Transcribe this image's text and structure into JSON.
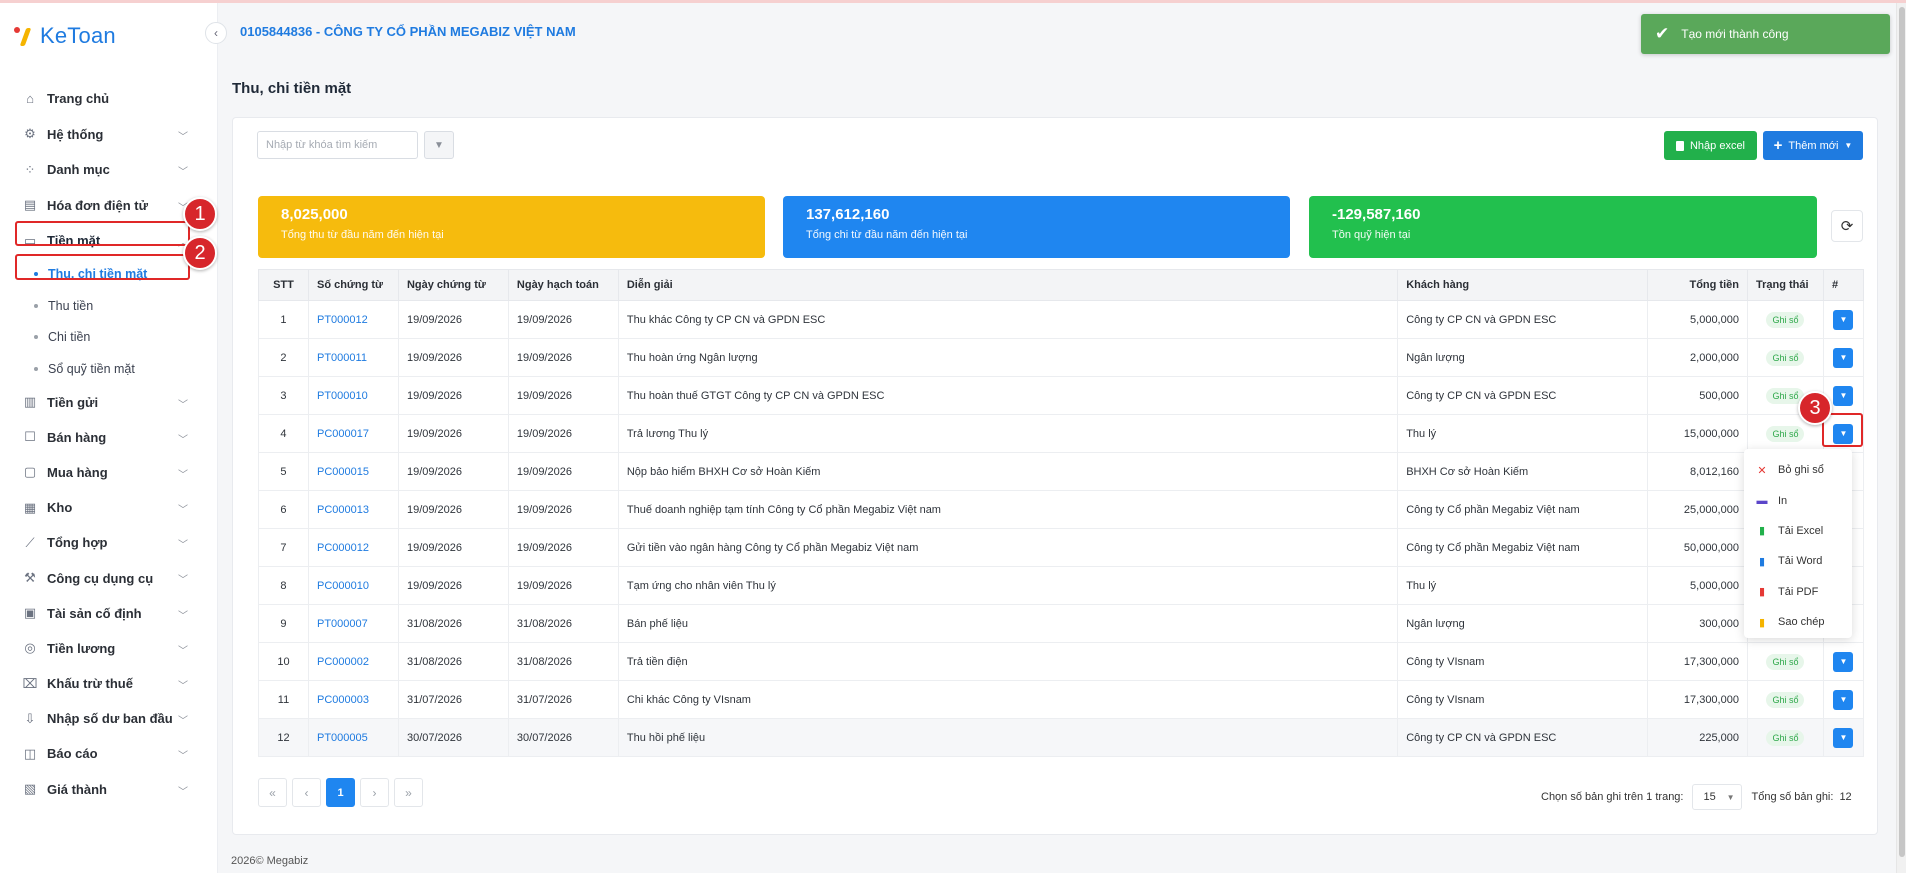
{
  "app": {
    "name": "KeToan"
  },
  "header": {
    "company": "0105844836 - CÔNG TY CỔ PHẦN MEGABIZ VIỆT NAM"
  },
  "toast": {
    "message": "Tạo mới thành công"
  },
  "sidebar": {
    "items": [
      {
        "label": "Trang chủ",
        "icon": "home-icon",
        "chevron": false
      },
      {
        "label": "Hệ thống",
        "icon": "gear-icon",
        "chevron": true
      },
      {
        "label": "Danh mục",
        "icon": "grid-icon",
        "chevron": true
      },
      {
        "label": "Hóa đơn điện tử",
        "icon": "invoice-icon",
        "chevron": true
      },
      {
        "label": "Tiền mặt",
        "icon": "cash-icon",
        "chevron": true,
        "open": true
      }
    ],
    "cash_sub": [
      "Thu, chi tiền mặt",
      "Thu tiền",
      "Chi tiền",
      "Sổ quỹ tiền mặt"
    ],
    "items_after": [
      {
        "label": "Tiền gửi",
        "icon": "bank-icon"
      },
      {
        "label": "Bán hàng",
        "icon": "sales-icon"
      },
      {
        "label": "Mua hàng",
        "icon": "purchase-icon"
      },
      {
        "label": "Kho",
        "icon": "warehouse-icon"
      },
      {
        "label": "Tổng hợp",
        "icon": "chart-icon"
      },
      {
        "label": "Công cụ dụng cụ",
        "icon": "tools-icon"
      },
      {
        "label": "Tài sản cố định",
        "icon": "asset-icon"
      },
      {
        "label": "Tiền lương",
        "icon": "salary-icon"
      },
      {
        "label": "Khấu trừ thuế",
        "icon": "tax-icon"
      },
      {
        "label": "Nhập số dư ban đầu",
        "icon": "import-icon"
      },
      {
        "label": "Báo cáo",
        "icon": "report-icon"
      },
      {
        "label": "Giá thành",
        "icon": "cost-icon"
      }
    ]
  },
  "page": {
    "title": "Thu, chi tiền mặt"
  },
  "toolbar": {
    "search_placeholder": "Nhập từ khóa tìm kiếm",
    "excel_label": "Nhập excel",
    "add_label": "Thêm mới"
  },
  "stats": {
    "income": {
      "value": "8,025,000",
      "label": "Tổng thu từ đầu năm đến hiện tại"
    },
    "expense": {
      "value": "137,612,160",
      "label": "Tổng chi từ đầu năm đến hiện tại"
    },
    "balance": {
      "value": "-129,587,160",
      "label": "Tồn quỹ hiện tại"
    }
  },
  "table": {
    "headers": [
      "STT",
      "Số chứng từ",
      "Ngày chứng từ",
      "Ngày hạch toán",
      "Diễn giải",
      "Khách hàng",
      "Tổng tiền",
      "Trạng thái",
      "#"
    ],
    "rows": [
      [
        "1",
        "PT000012",
        "19/09/2026",
        "19/09/2026",
        "Thu khác Công ty CP CN và GPDN ESC",
        "Công ty CP CN và GPDN ESC",
        "5,000,000",
        "Ghi sổ"
      ],
      [
        "2",
        "PT000011",
        "19/09/2026",
        "19/09/2026",
        "Thu hoàn ứng Ngân lượng",
        "Ngân lượng",
        "2,000,000",
        "Ghi sổ"
      ],
      [
        "3",
        "PT000010",
        "19/09/2026",
        "19/09/2026",
        "Thu hoàn thuế GTGT Công ty CP CN và GPDN ESC",
        "Công ty CP CN và GPDN ESC",
        "500,000",
        "Ghi sổ"
      ],
      [
        "4",
        "PC000017",
        "19/09/2026",
        "19/09/2026",
        "Trả lương Thu lý",
        "Thu lý",
        "15,000,000",
        "Ghi sổ"
      ],
      [
        "5",
        "PC000015",
        "19/09/2026",
        "19/09/2026",
        "Nộp bảo hiểm BHXH Cơ sở Hoàn Kiếm",
        "BHXH Cơ sở Hoàn Kiếm",
        "8,012,160",
        ""
      ],
      [
        "6",
        "PC000013",
        "19/09/2026",
        "19/09/2026",
        "Thuế doanh nghiệp tạm tính Công ty Cổ phần Megabiz Việt nam",
        "Công ty Cổ phần Megabiz Việt nam",
        "25,000,000",
        ""
      ],
      [
        "7",
        "PC000012",
        "19/09/2026",
        "19/09/2026",
        "Gửi tiền vào ngân hàng Công ty Cổ phần Megabiz Việt nam",
        "Công ty Cổ phần Megabiz Việt nam",
        "50,000,000",
        ""
      ],
      [
        "8",
        "PC000010",
        "19/09/2026",
        "19/09/2026",
        "Tạm ứng cho nhân viên Thu lý",
        "Thu lý",
        "5,000,000",
        ""
      ],
      [
        "9",
        "PT000007",
        "31/08/2026",
        "31/08/2026",
        "Bán phế liệu",
        "Ngân lượng",
        "300,000",
        ""
      ],
      [
        "10",
        "PC000002",
        "31/08/2026",
        "31/08/2026",
        "Trả tiền điện",
        "Công ty VIsnam",
        "17,300,000",
        "Ghi sổ"
      ],
      [
        "11",
        "PC000003",
        "31/07/2026",
        "31/07/2026",
        "Chi khác Công ty VIsnam",
        "Công ty VIsnam",
        "17,300,000",
        "Ghi sổ"
      ],
      [
        "12",
        "PT000005",
        "30/07/2026",
        "30/07/2026",
        "Thu hồi phế liệu",
        "Công ty CP CN và GPDN ESC",
        "225,000",
        "Ghi sổ"
      ]
    ]
  },
  "dropdown": {
    "items": [
      {
        "label": "Bỏ ghi sổ",
        "icon": "x-icon",
        "color": "#e53935"
      },
      {
        "label": "In",
        "icon": "printer-icon",
        "color": "#5b45c9"
      },
      {
        "label": "Tải Excel",
        "icon": "excel-icon",
        "color": "#22b04b"
      },
      {
        "label": "Tải Word",
        "icon": "word-icon",
        "color": "#1f7be0"
      },
      {
        "label": "Tải PDF",
        "icon": "pdf-icon",
        "color": "#e53935"
      },
      {
        "label": "Sao chép",
        "icon": "copy-icon",
        "color": "#f5b400"
      }
    ]
  },
  "pagination": {
    "current": "1",
    "per_page_label": "Chọn số bản ghi trên 1 trang:",
    "per_page": "15",
    "total_label": "Tổng số bản ghi:",
    "total": "12"
  },
  "annotations": [
    "1",
    "2",
    "3"
  ],
  "footer": {
    "text": "2026© Megabiz"
  },
  "colors": {
    "primary": "#1f7be0",
    "income": "#f6bb0d",
    "expense": "#1f86f0",
    "balance": "#22c04e",
    "highlight": "#e02828",
    "toast": "#5aa85a"
  }
}
